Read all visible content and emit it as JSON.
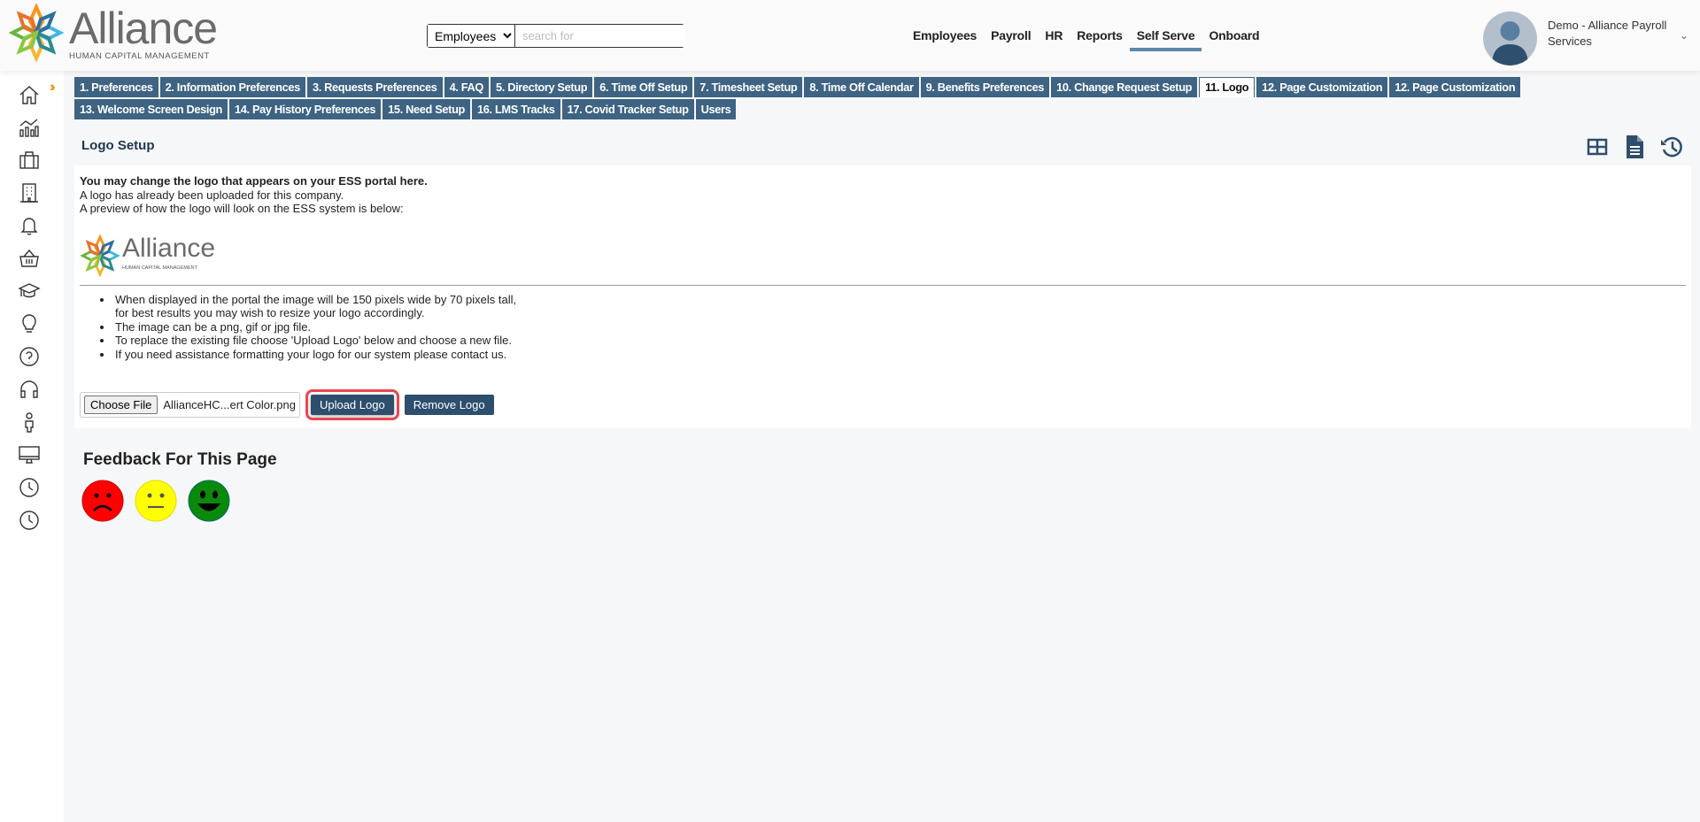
{
  "header": {
    "logo_word": "Alliance",
    "logo_sub": "HUMAN CAPITAL MANAGEMENT",
    "search": {
      "scope": "Employees",
      "placeholder": "search for"
    },
    "nav": [
      {
        "label": "Employees"
      },
      {
        "label": "Payroll"
      },
      {
        "label": "HR"
      },
      {
        "label": "Reports"
      },
      {
        "label": "Self Serve",
        "active": true
      },
      {
        "label": "Onboard"
      }
    ],
    "user": {
      "name": "Demo - Alliance Payroll Services"
    }
  },
  "sidebar": {
    "items": [
      "home",
      "analytics",
      "briefcase",
      "building",
      "bell",
      "basket",
      "graduation-cap",
      "lightbulb",
      "help",
      "headphones",
      "person",
      "monitor",
      "clock",
      "clock"
    ]
  },
  "tabs": {
    "row1": [
      "1. Preferences",
      "2. Information Preferences",
      "3. Requests Preferences",
      "4. FAQ",
      "5. Directory Setup",
      "6. Time Off Setup",
      "7. Timesheet Setup",
      "8. Time Off Calendar",
      "9. Benefits Preferences",
      "10. Change Request Setup",
      "11. Logo",
      "12. Page Customization",
      "12. Page Customization"
    ],
    "row2": [
      "13. Welcome Screen Design",
      "14. Pay History Preferences",
      "15. Need Setup",
      "16. LMS Tracks",
      "17. Covid Tracker Setup",
      "Users"
    ],
    "active": "11. Logo"
  },
  "page": {
    "title": "Logo Setup",
    "intro_bold": "You may change the logo that appears on your ESS portal here.",
    "line1": "A logo has already been uploaded for this company.",
    "line2": "A preview of how the logo will look on the ESS system is below:",
    "bullets": [
      "When displayed in the portal the image will be 150 pixels wide by 70 pixels tall,",
      "for best results you may wish to resize your logo accordingly.",
      "The image can be a png, gif or jpg file.",
      "To replace the existing file choose 'Upload Logo' below and choose a new file.",
      "If you need assistance formatting your logo for our system please contact us."
    ],
    "choose_file": "Choose File",
    "file_name": "AllianceHC...ert Color.png",
    "upload": "Upload Logo",
    "remove": "Remove Logo"
  },
  "feedback": {
    "title": "Feedback For This Page"
  },
  "colors": {
    "tab": "#3e6383",
    "button": "#2d4e6d",
    "accent": "#5b88aa",
    "highlight": "#e8484f"
  }
}
